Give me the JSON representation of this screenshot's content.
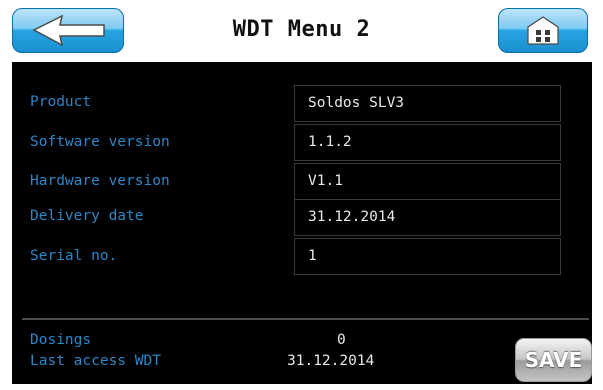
{
  "header": {
    "title": "WDT Menu 2",
    "back_icon": "arrow-left-icon",
    "home_icon": "home-icon",
    "button_color": "#27a4e2"
  },
  "info": {
    "rows": [
      {
        "label": "Product",
        "value": "Soldos SLV3"
      },
      {
        "label": "Software version",
        "value": "1.1.2"
      },
      {
        "label": "Hardware version",
        "value": "V1.1"
      },
      {
        "label": "Delivery date",
        "value": "31.12.2014"
      },
      {
        "label": "Serial no.",
        "value": "1"
      }
    ]
  },
  "footer": {
    "dosings_label": "Dosings",
    "dosings_value": "0",
    "last_access_label": "Last access WDT",
    "last_access_value": "31.12.2014",
    "save_label": "SAVE"
  },
  "colors": {
    "label": "#2b86c7",
    "value": "#e8e8e8",
    "background": "#000000"
  }
}
